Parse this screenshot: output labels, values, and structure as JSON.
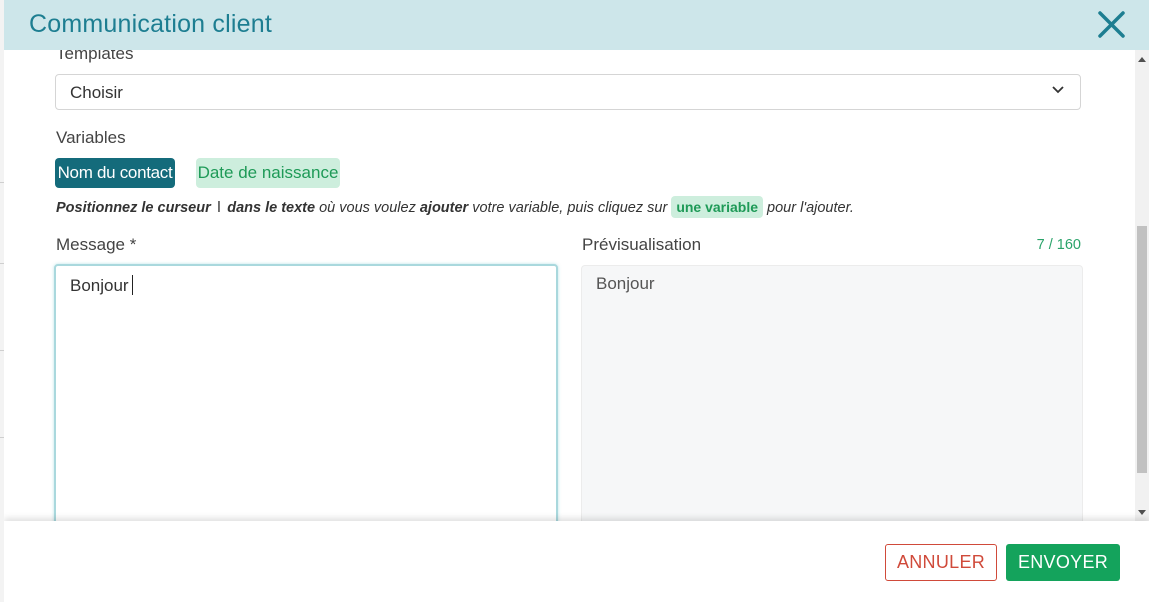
{
  "modal": {
    "title": "Communication client",
    "close_icon": "close-icon"
  },
  "templates": {
    "label": "Templates",
    "selected": "Choisir"
  },
  "variables": {
    "label": "Variables",
    "chips": [
      "Nom du contact",
      "Date de naissance"
    ]
  },
  "hint": {
    "part1": "Positionnez le curseur",
    "cursor_glyph": "I",
    "part2": "dans le texte",
    "part3": "où vous voulez",
    "part4": "ajouter",
    "part5": "votre variable, puis cliquez sur",
    "chip": "une variable",
    "part6": "pour l'ajouter."
  },
  "message": {
    "label": "Message *",
    "value": "Bonjour"
  },
  "preview": {
    "label": "Prévisualisation",
    "counter": "7 / 160",
    "text": "Bonjour"
  },
  "footer": {
    "cancel_label": "ANNULER",
    "send_label": "ENVOYER"
  },
  "colors": {
    "header_bg": "#cde6ea",
    "title": "#1d7e91",
    "chip_primary": "#146b7b",
    "chip_secondary_bg": "#cdeedd",
    "chip_secondary_text": "#1e9a57",
    "cancel": "#d04a3a",
    "send": "#14a35c"
  }
}
